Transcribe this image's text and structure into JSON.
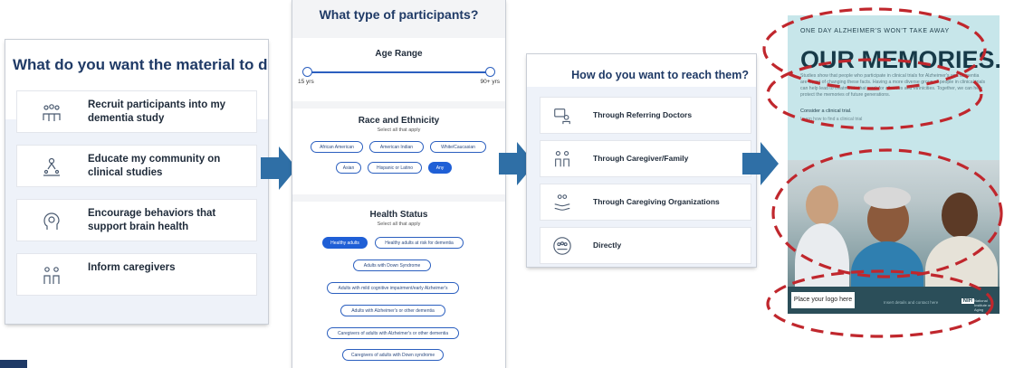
{
  "panel1": {
    "title": "What do you want the material to do?",
    "options": [
      {
        "label": "Recruit participants into my dementia study",
        "icon": "people-group-icon"
      },
      {
        "label": "Educate my community on clinical studies",
        "icon": "presenter-icon"
      },
      {
        "label": "Encourage behaviors that support brain health",
        "icon": "brain-head-icon"
      },
      {
        "label": "Inform caregivers",
        "icon": "caregiver-icon"
      }
    ]
  },
  "panel2": {
    "title": "What type of participants?",
    "age": {
      "title": "Age Range",
      "min_label": "15 yrs",
      "max_label": "90+ yrs"
    },
    "race": {
      "title": "Race and Ethnicity",
      "subtitle": "Select all that apply",
      "options": [
        "African American",
        "American Indian",
        "White/Caucasian",
        "Asian",
        "Hispanic or Latino",
        "Any"
      ],
      "selected": "Any"
    },
    "health": {
      "title": "Health Status",
      "subtitle": "Select all that apply",
      "options": [
        "Healthy adults",
        "Healthy adults at risk for dementia",
        "Adults with Down Syndrome",
        "Adults with mild cognitive impairment/early Alzheimer's",
        "Adults with Alzheimer's or other dementia",
        "Caregivers of adults with Alzheimer's or other dementia",
        "Caregivers of adults with Down syndrome"
      ],
      "selected": "Healthy adults"
    }
  },
  "panel3": {
    "title": "How do you want to reach them?",
    "options": [
      {
        "label": "Through Referring Doctors",
        "icon": "doctor-icon"
      },
      {
        "label": "Through Caregiver/Family",
        "icon": "family-icon"
      },
      {
        "label": "Through Caregiving Organizations",
        "icon": "hands-heart-icon"
      },
      {
        "label": "Directly",
        "icon": "community-icon"
      }
    ]
  },
  "poster": {
    "tagline": "ONE DAY ALZHEIMER'S WON'T TAKE AWAY",
    "headline": "OUR MEMORIES.",
    "body": "Studies show that people who participate in clinical trials for Alzheimer's and dementia are a part of changing these facts. Having a more diverse group of people in clinical trials can help lead to treatments that work for all races and ethnicities. Together, we can help protect the memories of future generations.",
    "consider": "Consider a clinical trial.",
    "learn": "Learn how to find a clinical trial",
    "logo_placeholder": "Place your logo here",
    "footer_text": "Insert details and contact here",
    "nih": "NIH",
    "nih_name": "National Institute on Aging"
  },
  "colors": {
    "accent": "#1f5fd6",
    "title": "#1f3a66",
    "arrow": "#2f6fa6",
    "dash": "#c0272d",
    "poster_teal": "#c7e6ea"
  }
}
